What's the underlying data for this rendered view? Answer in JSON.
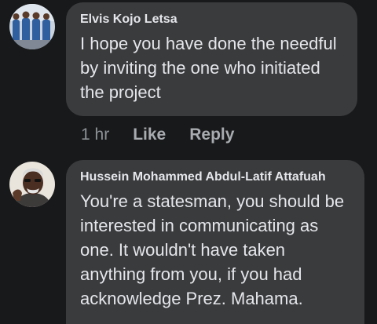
{
  "comments": [
    {
      "author": "Elvis Kojo Letsa",
      "text": "I hope you have done the needful by inviting the one who initiated the project",
      "time": "1 hr",
      "like_label": "Like",
      "reply_label": "Reply"
    },
    {
      "author": "Hussein Mohammed Abdul-Latif Attafuah",
      "text": "You're a statesman, you should be interested in communicating as one. It wouldn't have taken anything from you, if you had acknowledge Prez. Mahama."
    }
  ]
}
